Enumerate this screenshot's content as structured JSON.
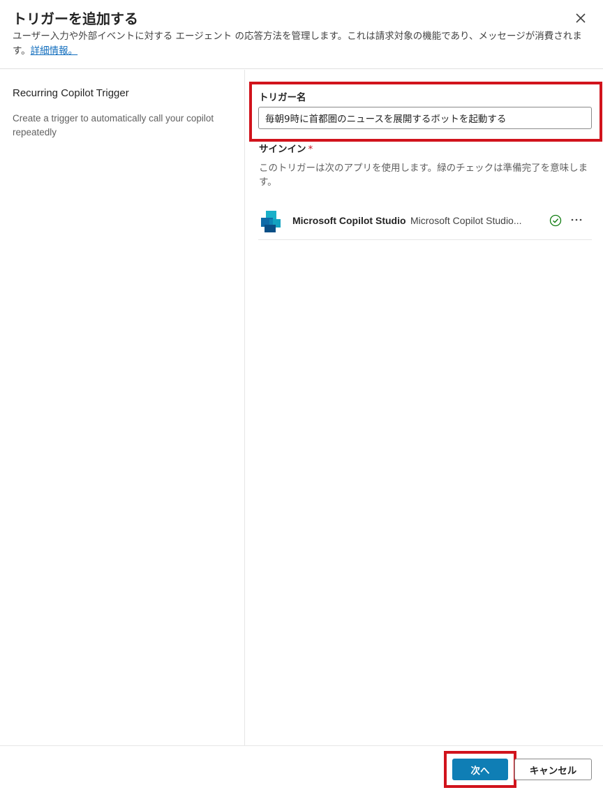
{
  "dialog": {
    "title": "トリガーを追加する",
    "description": "ユーザー入力や外部イベントに対する エージェント の応答方法を管理します。これは請求対象の機能であり、メッセージが消費されます。",
    "learn_more_link": "詳細情報。"
  },
  "trigger_info": {
    "name": "Recurring Copilot Trigger",
    "description": "Create a trigger to automatically call your copilot repeatedly"
  },
  "form": {
    "trigger_name_label": "トリガー名",
    "trigger_name_value": "毎朝9時に首都圏のニュースを展開するボットを起動する",
    "signin_label": "サインイン",
    "required_marker": "*",
    "signin_description": "このトリガーは次のアプリを使用します。緑のチェックは準備完了を意味します。"
  },
  "apps": [
    {
      "name": "Microsoft Copilot Studio",
      "connection": "Microsoft Copilot Studio...",
      "status": "ready",
      "icon": "copilot-studio-logo",
      "status_icon": "check-circle-icon"
    }
  ],
  "footer": {
    "next_label": "次へ",
    "cancel_label": "キャンセル"
  },
  "colors": {
    "primary_button": "#0f7eb5",
    "highlight_border": "#d1131c",
    "link": "#0f6cbd",
    "success": "#107c10",
    "required": "#c50f1f"
  }
}
